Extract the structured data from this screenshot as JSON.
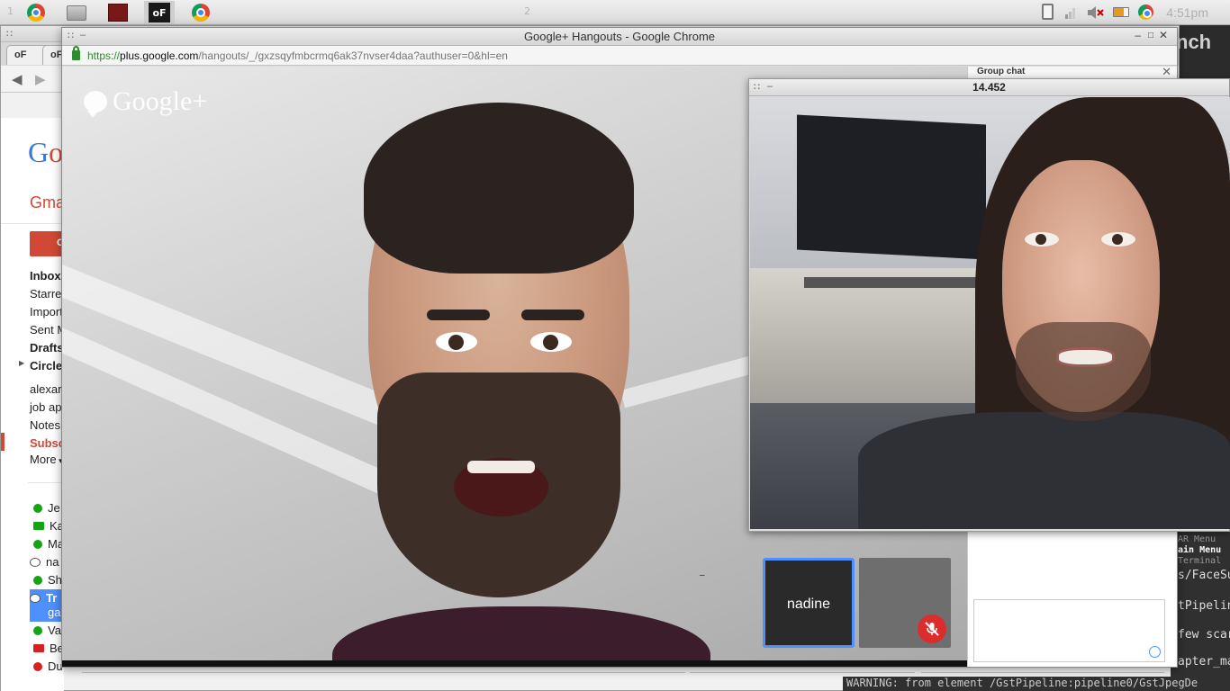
{
  "panel": {
    "workspaces": [
      "1",
      "2"
    ],
    "clock": "4:51pm",
    "launchers": [
      {
        "name": "chrome-icon"
      },
      {
        "name": "files-icon"
      },
      {
        "name": "presentation-icon"
      },
      {
        "name": "openframeworks-icon",
        "label": "oF"
      },
      {
        "name": "chrome-icon"
      }
    ],
    "tray": [
      "clipboard-icon",
      "signal-icon",
      "volume-muted-icon",
      "battery-icon",
      "chrome-icon"
    ]
  },
  "background_window": {
    "tabs": [
      "oF",
      "oF"
    ],
    "gmail": {
      "logo_parts": [
        "G",
        "o"
      ],
      "label": "Gma",
      "compose": "C",
      "folders": [
        "Inbox",
        "Starre",
        "Import",
        "Sent M",
        "Drafts",
        "Circle",
        "alexar",
        "job ap",
        "Notes",
        "Subsc",
        "More"
      ],
      "contacts": [
        "Je",
        "Ka",
        "Ma",
        "na",
        "Sh",
        "Tr",
        "ga",
        "Va",
        "Be",
        "Du"
      ]
    },
    "launch_text": "nch",
    "terminal": {
      "lines": [
        "AR Menu",
        "ain Menu",
        "Terminal",
        "s/FaceSu",
        "tPipelin",
        "few scar",
        "apter_ma"
      ],
      "bottom": "WARNING: from element /GstPipeline:pipeline0/GstJpegDe"
    }
  },
  "hangouts_window": {
    "title": "Google+ Hangouts - Google Chrome",
    "url": {
      "scheme": "https://",
      "host": "plus.google.com",
      "path": "/hangouts/_/gxzsqyfmbcrmq6ak37nvser4daa?authuser=0&hl=en"
    },
    "brand": "Google+",
    "chat_title": "Group chat",
    "participants": [
      {
        "name": "nadine",
        "selected": true
      },
      {
        "name": "",
        "muted": true
      }
    ]
  },
  "floating_window": {
    "title": "14.452"
  },
  "colors": {
    "gmail_red": "#d14836",
    "hangouts_blue": "#4d90fe",
    "mute_red": "#dd2c2c",
    "url_green": "#2e8b2e"
  }
}
